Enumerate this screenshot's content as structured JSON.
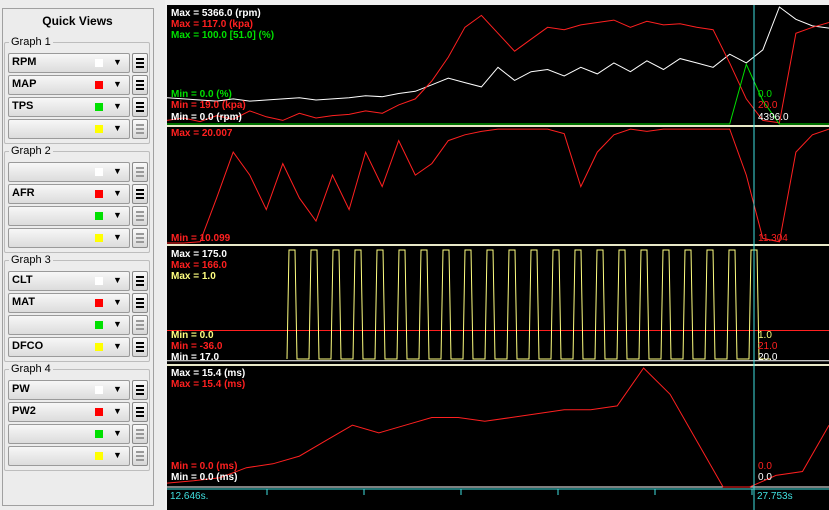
{
  "sidebar": {
    "title": "Quick Views",
    "groups": [
      {
        "label": "Graph 1",
        "rows": [
          {
            "field": "RPM",
            "color": "#ffffff"
          },
          {
            "field": "MAP",
            "color": "#ff0000"
          },
          {
            "field": "TPS",
            "color": "#00e000"
          },
          {
            "field": "",
            "color": "#ffff00"
          }
        ]
      },
      {
        "label": "Graph 2",
        "rows": [
          {
            "field": "",
            "color": "#ffffff"
          },
          {
            "field": "AFR",
            "color": "#ff0000"
          },
          {
            "field": "",
            "color": "#00e000"
          },
          {
            "field": "",
            "color": "#ffff00"
          }
        ]
      },
      {
        "label": "Graph 3",
        "rows": [
          {
            "field": "CLT",
            "color": "#ffffff"
          },
          {
            "field": "MAT",
            "color": "#ff0000"
          },
          {
            "field": "",
            "color": "#00e000"
          },
          {
            "field": "DFCO",
            "color": "#ffff00"
          }
        ]
      },
      {
        "label": "Graph 4",
        "rows": [
          {
            "field": "PW",
            "color": "#ffffff"
          },
          {
            "field": "PW2",
            "color": "#ff0000"
          },
          {
            "field": "",
            "color": "#00e000"
          },
          {
            "field": "",
            "color": "#ffff00"
          }
        ]
      }
    ]
  },
  "graphs": {
    "g1": {
      "max_rpm": "Max = 5366.0 (rpm)",
      "max_map": "Max = 117.0 (kpa)",
      "max_tps": "Max = 100.0 [51.0] (%)",
      "min_tps": "Min = 0.0 (%)",
      "min_map": "Min = 19.0 (kpa)",
      "min_rpm": "Min = 0.0 (rpm)",
      "cur_tps": "0.0",
      "cur_map": "20.0",
      "cur_rpm": "4396.0"
    },
    "g2": {
      "max_afr": "Max = 20.007",
      "min_afr": "Min = 10.099",
      "cur_afr": "11.304"
    },
    "g3": {
      "max_clt": "Max = 175.0",
      "max_mat": "Max = 166.0",
      "max_dfco": "Max = 1.0",
      "min_dfco": "Min = 0.0",
      "min_mat": "Min = -36.0",
      "min_clt": "Min = 17.0",
      "cur_dfco": "1.0",
      "cur_mat": "21.0",
      "cur_clt": "20.0"
    },
    "g4": {
      "max_pw": "Max = 15.4 (ms)",
      "max_pw2": "Max = 15.4 (ms)",
      "min_pw2": "Min = 0.0 (ms)",
      "min_pw": "Min = 0.0 (ms)",
      "cur_pw2": "0.0",
      "cur_pw": "0.0"
    },
    "time": {
      "start": "12.646s.",
      "cursor": "27.753s"
    }
  },
  "colors": {
    "white": "#ffffff",
    "red": "#ff2020",
    "green": "#00e000",
    "yellow": "#ffff80",
    "cyan": "#40e0e0",
    "divider": "#e8e8c8"
  },
  "chart_data": {
    "type": "line",
    "x_range_s": [
      12.646,
      27.753
    ],
    "panels": [
      {
        "series": [
          {
            "name": "RPM",
            "range": [
              0,
              5366
            ],
            "values": [
              1200,
              1150,
              1100,
              1050,
              1150,
              1050,
              1100,
              1150,
              1200,
              1100,
              1150,
              1200,
              1300,
              1250,
              1400,
              1500,
              1800,
              2100,
              1900,
              1700,
              2600,
              2000,
              2400,
              2500,
              2200,
              2600,
              2300,
              2800,
              2400,
              2900,
              2500,
              3000,
              2800,
              2600,
              3200,
              2800,
              3400,
              5366,
              4800,
              4500,
              4400
            ]
          },
          {
            "name": "MAP",
            "range": [
              19,
              117
            ],
            "values": [
              22,
              24,
              21,
              26,
              23,
              30,
              25,
              22,
              28,
              24,
              26,
              27,
              30,
              28,
              35,
              40,
              55,
              75,
              100,
              110,
              95,
              80,
              90,
              100,
              98,
              102,
              104,
              106,
              100,
              105,
              102,
              103,
              100,
              98,
              70,
              40,
              22,
              20,
              95,
              100,
              104
            ]
          },
          {
            "name": "TPS",
            "range": [
              0,
              100
            ],
            "values": [
              0,
              0,
              0,
              0,
              0,
              0,
              0,
              0,
              0,
              0,
              0,
              0,
              0,
              0,
              0,
              0,
              0,
              0,
              0,
              0,
              0,
              0,
              0,
              0,
              0,
              0,
              0,
              0,
              0,
              0,
              0,
              0,
              0,
              0,
              0,
              51,
              20,
              0,
              0,
              0,
              0
            ]
          }
        ]
      },
      {
        "series": [
          {
            "name": "AFR",
            "range": [
              10.099,
              20.007
            ],
            "values": [
              10.1,
              10.1,
              10.2,
              14,
              18,
              16,
              13,
              17,
              14,
              12,
              16,
              13,
              18,
              15,
              19,
              16,
              17,
              19,
              19.5,
              19.8,
              20,
              20,
              20,
              20,
              19.6,
              15,
              18,
              19.5,
              20,
              19.8,
              20,
              20,
              20,
              20,
              20,
              16,
              10.5,
              10.2,
              18,
              19.5,
              20
            ]
          }
        ]
      },
      {
        "series": [
          {
            "name": "CLT",
            "range": [
              17,
              175
            ],
            "values": [
              20,
              20,
              20,
              20,
              20,
              20,
              20,
              20,
              20,
              20
            ]
          },
          {
            "name": "MAT",
            "range": [
              -36,
              166
            ],
            "values": [
              21,
              21,
              21,
              21,
              21,
              21,
              21,
              21,
              21,
              21
            ]
          },
          {
            "name": "DFCO",
            "range": [
              0,
              1
            ],
            "values": [
              0,
              1,
              0,
              1,
              0,
              1,
              0,
              1,
              0,
              1
            ]
          }
        ]
      },
      {
        "series": [
          {
            "name": "PW",
            "range": [
              0,
              15.4
            ],
            "values": [
              0,
              0,
              0,
              0,
              0,
              0,
              0,
              0,
              0,
              0
            ]
          },
          {
            "name": "PW2",
            "range": [
              0,
              15.4
            ],
            "values": [
              0.5,
              0.8,
              1.2,
              2.5,
              3,
              4,
              6,
              8,
              7,
              8,
              9,
              9,
              8.5,
              9,
              9.5,
              10,
              10,
              10.5,
              15.4,
              12,
              6,
              0,
              0,
              1.5,
              2,
              8
            ]
          }
        ]
      }
    ]
  }
}
